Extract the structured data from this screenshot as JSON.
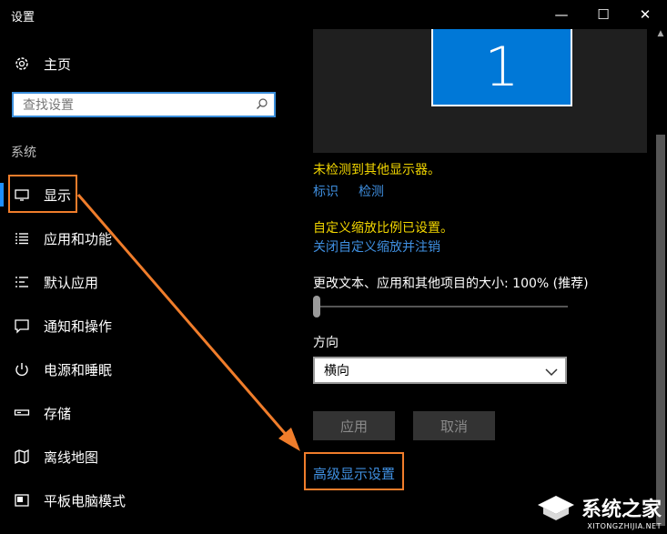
{
  "window": {
    "title": "设置",
    "minimize_glyph": "—",
    "maximize_glyph": "☐",
    "close_glyph": "✕"
  },
  "sidebar": {
    "home_label": "主页",
    "search_placeholder": "查找设置",
    "section_label": "系统",
    "items": [
      {
        "label": "显示",
        "icon": "monitor-icon",
        "active": true
      },
      {
        "label": "应用和功能",
        "icon": "apps-list-icon"
      },
      {
        "label": "默认应用",
        "icon": "default-apps-icon"
      },
      {
        "label": "通知和操作",
        "icon": "notification-icon"
      },
      {
        "label": "电源和睡眠",
        "icon": "power-icon"
      },
      {
        "label": "存储",
        "icon": "storage-icon"
      },
      {
        "label": "离线地图",
        "icon": "map-icon"
      },
      {
        "label": "平板电脑模式",
        "icon": "tablet-icon"
      }
    ]
  },
  "display": {
    "monitor_number": "1",
    "no_other_display": "未检测到其他显示器。",
    "identify_link": "标识",
    "detect_link": "检测",
    "custom_scaling_notice": "自定义缩放比例已设置。",
    "turn_off_custom_scaling_link": "关闭自定义缩放并注销",
    "scale_label": "更改文本、应用和其他项目的大小: 100% (推荐)",
    "scale_value_fraction": 0,
    "orientation_label": "方向",
    "orientation_value": "横向",
    "apply_button": "应用",
    "cancel_button": "取消",
    "advanced_link": "高级显示设置"
  },
  "colors": {
    "accent": "#0078d7",
    "link": "#3f8fe0",
    "warning": "#f2d600",
    "highlight_box": "#f07d2b"
  },
  "watermark": {
    "brand": "系统之家",
    "url": "XITONGZHIJIA.NET"
  }
}
